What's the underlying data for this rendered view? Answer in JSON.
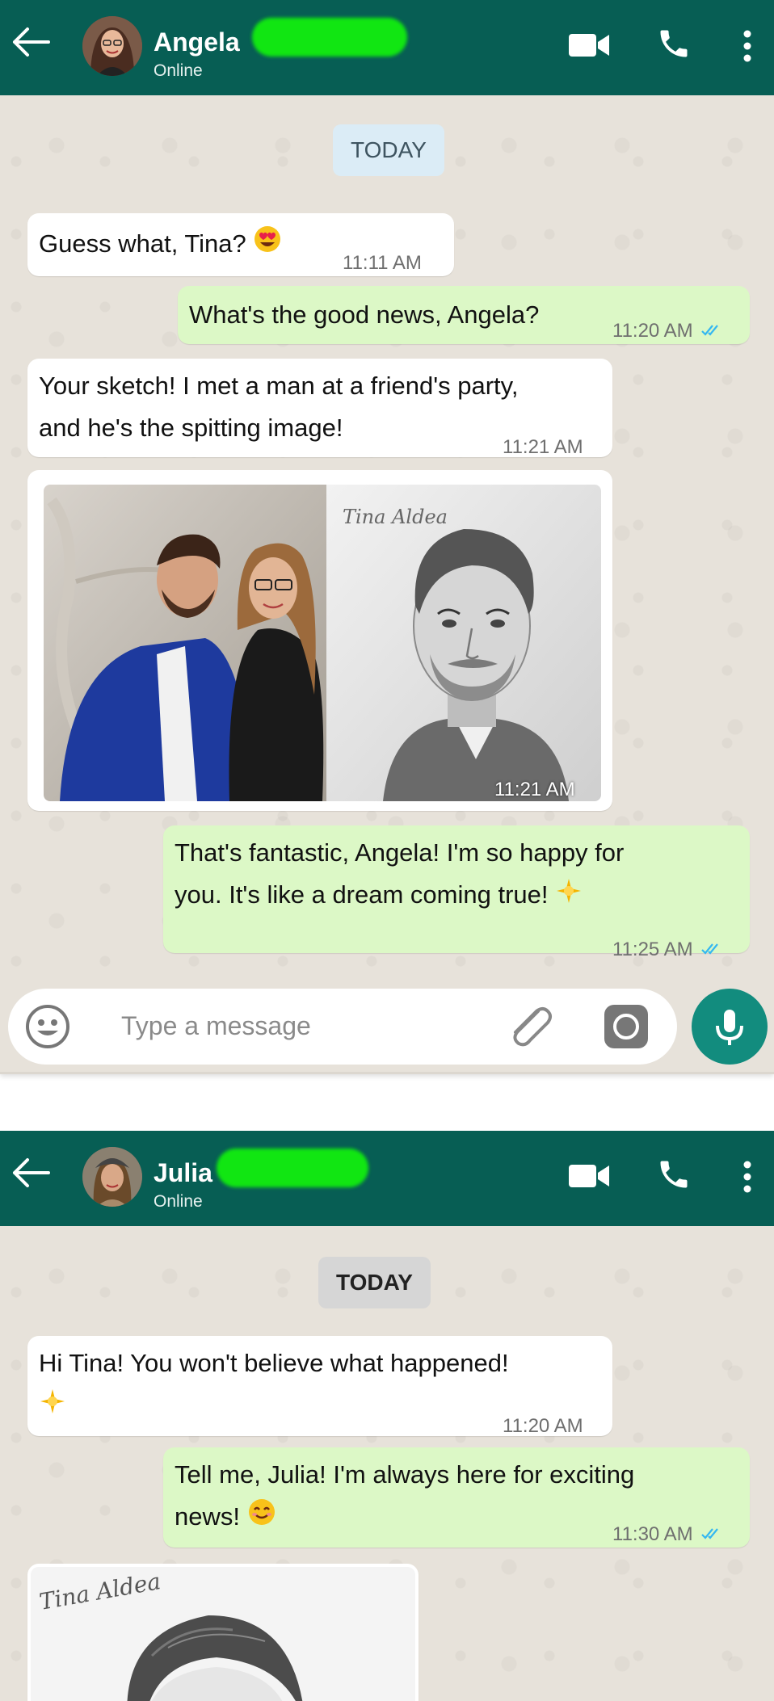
{
  "colors": {
    "header": "#075e54",
    "incoming_bubble": "#ffffff",
    "outgoing_bubble": "#dcf8c6",
    "read_ticks": "#34b7f1",
    "mic_button": "#128c7e",
    "redaction": "#11e612"
  },
  "chat1": {
    "contact_name": "Angela",
    "contact_status": "Online",
    "date_label": "TODAY",
    "messages": [
      {
        "direction": "incoming",
        "lines": [
          "Guess what, Tina?"
        ],
        "emoji": "heart-eyes-emoji",
        "time": "11:11 AM"
      },
      {
        "direction": "outgoing",
        "lines": [
          "What's the good news, Angela?"
        ],
        "time": "11:20 AM",
        "read": true
      },
      {
        "direction": "incoming",
        "lines": [
          "Your sketch! I met a man at a friend's party,",
          "and he's the spitting image!"
        ],
        "time": "11:21 AM"
      },
      {
        "direction": "incoming",
        "type": "image",
        "photo_description": "couple photo and pencil portrait sketch",
        "signature": "Tina Aldea",
        "time": "11:21 AM"
      },
      {
        "direction": "outgoing",
        "lines": [
          "That's fantastic, Angela! I'm so happy for",
          "you. It's like a dream coming true!"
        ],
        "emoji": "sparkle-emoji",
        "time": "11:25 AM",
        "read": true
      }
    ],
    "composer_placeholder": "Type a message"
  },
  "chat2": {
    "contact_name": "Julia",
    "contact_status": "Online",
    "date_label": "TODAY",
    "messages": [
      {
        "direction": "incoming",
        "lines": [
          "Hi Tina! You won't believe what happened!"
        ],
        "emoji": "sparkle-emoji",
        "time": "11:20 AM"
      },
      {
        "direction": "outgoing",
        "lines": [
          "Tell me, Julia! I'm always here for exciting",
          "news!"
        ],
        "emoji": "smiling-emoji",
        "time": "11:30 AM",
        "read": true
      },
      {
        "direction": "incoming",
        "type": "image",
        "photo_description": "pencil portrait sketch (partial)",
        "signature": "Tina Aldea"
      }
    ]
  }
}
